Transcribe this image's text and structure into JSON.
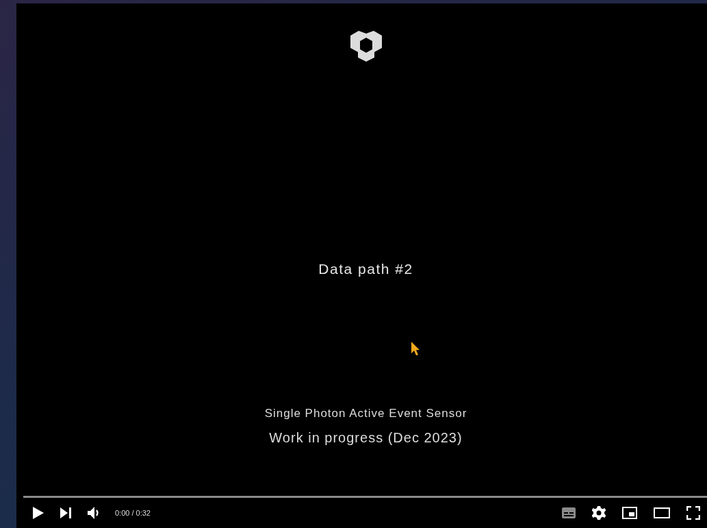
{
  "slide": {
    "title": "Data path #2",
    "lines": [
      "Single Photon Active Event Sensor",
      "Work in progress (Dec 2023)"
    ]
  },
  "progress": {
    "level": 0
  },
  "time": "0:00 / 0:32",
  "captions": {
    "on": false
  }
}
